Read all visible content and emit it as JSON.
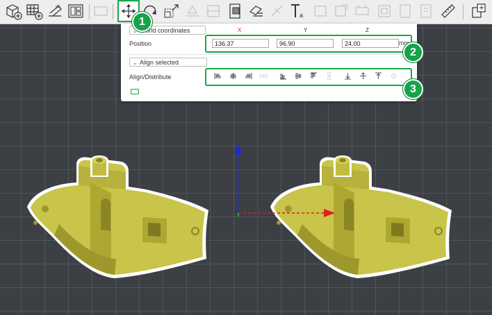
{
  "toolbar": {
    "buttons": [
      {
        "name": "add-object-icon",
        "state": "normal"
      },
      {
        "name": "add-plate-icon",
        "state": "normal"
      },
      {
        "name": "auto-orient-icon",
        "state": "normal"
      },
      {
        "name": "arrange-icon",
        "state": "normal"
      },
      {
        "name": "split-icon",
        "state": "disabled"
      },
      {
        "name": "move-icon",
        "state": "active"
      },
      {
        "name": "rotate-icon",
        "state": "normal"
      },
      {
        "name": "scale-icon",
        "state": "normal"
      },
      {
        "name": "lay-on-face-icon",
        "state": "disabled"
      },
      {
        "name": "cut-icon",
        "state": "disabled"
      },
      {
        "name": "mesh-boolean-icon",
        "state": "normal"
      },
      {
        "name": "support-paint-icon",
        "state": "normal"
      },
      {
        "name": "seam-paint-icon",
        "state": "disabled"
      },
      {
        "name": "text-icon",
        "state": "normal"
      },
      {
        "name": "color-paint-icon",
        "state": "disabled"
      },
      {
        "name": "fuzzy-skin-icon",
        "state": "disabled"
      },
      {
        "name": "emboss-icon",
        "state": "disabled"
      },
      {
        "name": "simplify-icon",
        "state": "disabled"
      },
      {
        "name": "brim-ears-icon",
        "state": "disabled"
      },
      {
        "name": "measure-icon",
        "state": "normal"
      },
      {
        "name": "assembly-icon",
        "state": "normal"
      }
    ]
  },
  "panel": {
    "coord_system": "World coordinates",
    "axes": {
      "x": "X",
      "y": "Y",
      "z": "Z"
    },
    "position_label": "Position",
    "position": {
      "x": "136.37",
      "y": "96.90",
      "z": "24.00"
    },
    "unit": "mm",
    "align_mode": "Align selected",
    "align_label": "Align/Distribute",
    "align_buttons": [
      {
        "name": "align-left-icon",
        "enabled": true
      },
      {
        "name": "align-center-x-icon",
        "enabled": true
      },
      {
        "name": "align-right-icon",
        "enabled": true
      },
      {
        "name": "distribute-x-icon",
        "enabled": false
      },
      {
        "name": "align-front-icon",
        "enabled": true
      },
      {
        "name": "align-center-y-icon",
        "enabled": true
      },
      {
        "name": "align-back-icon",
        "enabled": true
      },
      {
        "name": "distribute-y-icon",
        "enabled": false
      },
      {
        "name": "align-bottom-icon",
        "enabled": true
      },
      {
        "name": "align-center-z-icon",
        "enabled": true
      },
      {
        "name": "align-top-icon",
        "enabled": true
      },
      {
        "name": "distribute-z-icon",
        "enabled": false
      }
    ]
  },
  "callouts": [
    "1",
    "2",
    "3"
  ],
  "colors": {
    "highlight": "#19a64a",
    "model": "#c9c44a",
    "axis_x": "#e02020",
    "axis_y": "#20b020",
    "axis_z": "#1a2ad8",
    "grid_bg": "#3c3f44"
  }
}
